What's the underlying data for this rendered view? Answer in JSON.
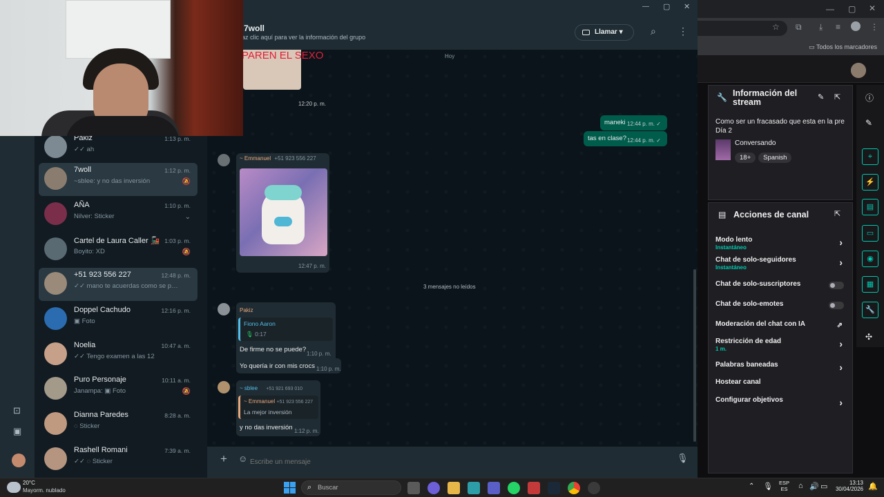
{
  "browser": {
    "bookmarks_label": "Todos los marcadores"
  },
  "stream_info": {
    "title": "Información del stream",
    "stream_title": "Como ser un fracasado que esta en la pre Día 2",
    "category": "Conversando",
    "tags": [
      "18+",
      "Spanish"
    ]
  },
  "channel_actions": {
    "title": "Acciones de canal",
    "items": [
      {
        "label": "Modo lento",
        "sub": "Instantáneo",
        "control": "chevron"
      },
      {
        "label": "Chat de solo-seguidores",
        "sub": "Instantáneo",
        "control": "chevron"
      },
      {
        "label": "Chat de solo-suscriptores",
        "sub": "",
        "control": "toggle"
      },
      {
        "label": "Chat de solo-emotes",
        "sub": "",
        "control": "toggle"
      },
      {
        "label": "Moderación del chat con IA",
        "sub": "",
        "control": "external"
      },
      {
        "label": "Restricción de edad",
        "sub": "1 m.",
        "control": "chevron"
      },
      {
        "label": "Palabras baneadas",
        "sub": "",
        "control": "chevron"
      },
      {
        "label": "Hostear canal",
        "sub": "",
        "control": "none"
      },
      {
        "label": "Configurar objetivos",
        "sub": "",
        "control": "chevron"
      }
    ]
  },
  "chats": [
    {
      "name": "Pakiz",
      "time": "1:13 p. m.",
      "last": "✓✓ ah",
      "icon": ""
    },
    {
      "name": "7woll",
      "time": "1:12 p. m.",
      "last": "~sblee: y no das inversión",
      "icon": "🔕"
    },
    {
      "name": "AÑA",
      "time": "1:10 p. m.",
      "last": "Nilver: Sticker",
      "icon": "⌄"
    },
    {
      "name": "Cartel de Laura Caller 🚂",
      "time": "1:03 p. m.",
      "last": "Boyito: XD",
      "icon": "🔕"
    },
    {
      "name": "+51 923 556 227",
      "time": "12:48 p. m.",
      "last": "✓✓ mano te acuerdas como se ponía ...",
      "icon": ""
    },
    {
      "name": "Doppel Cachudo",
      "time": "12:16 p. m.",
      "last": "▣ Foto",
      "icon": ""
    },
    {
      "name": "Noelia",
      "time": "10:47 a. m.",
      "last": "✓✓ Tengo examen a las 12",
      "icon": ""
    },
    {
      "name": "Puro Personaje",
      "time": "10:11 a. m.",
      "last": "Janampa: ▣ Foto",
      "icon": "🔕"
    },
    {
      "name": "Dianna Paredes",
      "time": "8:28 a. m.",
      "last": "◌ Sticker",
      "icon": ""
    },
    {
      "name": "Rashell Romani",
      "time": "7:39 a. m.",
      "last": "✓✓ ◌ Sticker",
      "icon": ""
    }
  ],
  "header": {
    "group_name": "7woll",
    "group_info": "az clic aquí para ver la información del grupo",
    "call_label": "Llamar"
  },
  "messages": {
    "sticker_caption": "PAREN EL SEXO",
    "sticker_time": "12:20 p. m.",
    "today_chip": "Hoy",
    "out1_text": "maneki",
    "out1_time": "12:44 p. m.",
    "out2_text": "tas en clase?",
    "out2_time": "12:44 p. m.",
    "emmanuel_sender": "~ Emmanuel",
    "emmanuel_phone": "+51 923 556 227",
    "emmanuel_time": "12:47 p. m.",
    "unread_chip": "3 mensajes no leídos",
    "pakiz_sender": "Pakiz",
    "pakiz_quote_name": "Fiono Aaron",
    "pakiz_quote_audio": "0:17",
    "pakiz_msg1": "De firme no se puede?",
    "pakiz_msg1_time": "1:10 p. m.",
    "pakiz_msg2": "Yo quería ir con mis crocs",
    "pakiz_msg2_time": "1:10 p. m.",
    "sblee_sender": "~ sblee",
    "sblee_phone": "+51 921 693 010",
    "sblee_quote_name": "~ Emmanuel",
    "sblee_quote_phone": "+51 923 556 227",
    "sblee_quote_text": "La mejor inversión",
    "sblee_msg": "y no das inversión",
    "sblee_time": "1:12 p. m."
  },
  "composer": {
    "placeholder": "Escribe un mensaje"
  },
  "taskbar": {
    "weather_temp": "20°C",
    "weather_desc": "Mayorm. nublado",
    "search_placeholder": "Buscar",
    "lang_top": "ESP",
    "lang_bottom": "ES",
    "time": "13:13",
    "date": "30/04/2026"
  }
}
